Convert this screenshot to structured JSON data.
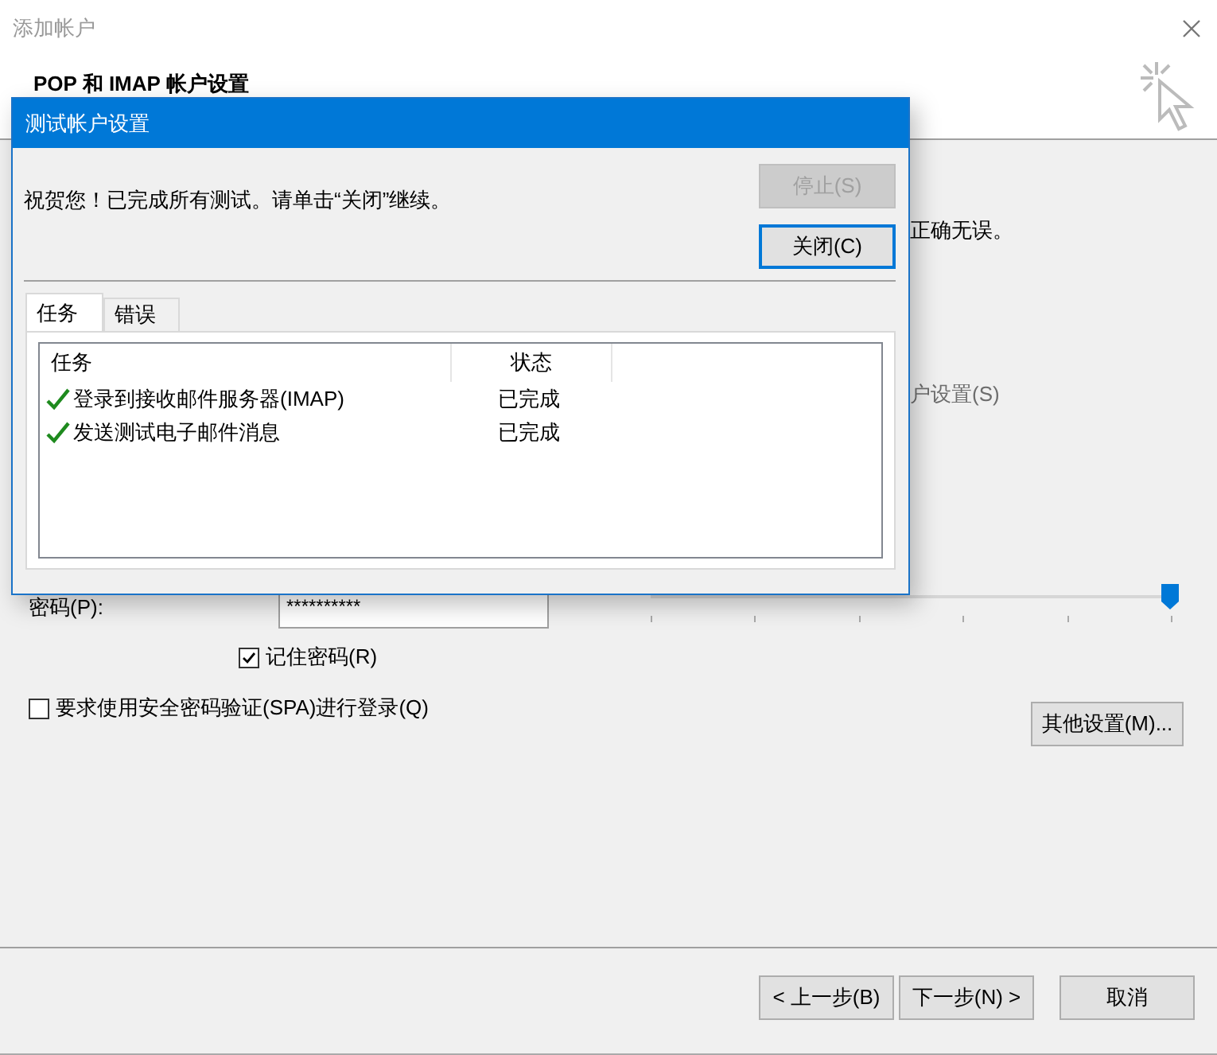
{
  "window": {
    "title": "添加帐户"
  },
  "header": {
    "title": "POP 和 IMAP 帐户设置"
  },
  "partial_texts": [
    {
      "text": "正确无误。",
      "disabled": false
    },
    {
      "text": "户设置(S)",
      "disabled": true
    }
  ],
  "password": {
    "label": "密码(P):",
    "value": "**********"
  },
  "slider": {
    "level": 1
  },
  "remember": {
    "label": "记住密码(R)",
    "checked": true
  },
  "spa": {
    "label": "要求使用安全密码验证(SPA)进行登录(Q)",
    "checked": false
  },
  "more_button": {
    "label": "其他设置(M)..."
  },
  "footer_buttons": [
    {
      "label": "< 上一步(B)"
    },
    {
      "label": "下一步(N) >"
    },
    {
      "label": "取消"
    }
  ],
  "dialog": {
    "title": "测试帐户设置",
    "message": "祝贺您！已完成所有测试。请单击“关闭”继续。",
    "buttons": [
      {
        "label": "停止(S)",
        "disabled": true,
        "focused": false
      },
      {
        "label": "关闭(C)",
        "disabled": false,
        "focused": true
      }
    ],
    "tabs": [
      {
        "label": "任务",
        "selected": true
      },
      {
        "label": "错误",
        "selected": false
      }
    ],
    "columns": [
      "任务",
      "状态"
    ],
    "rows": [
      {
        "task": "登录到接收邮件服务器(IMAP)",
        "status": "已完成",
        "kind": "success"
      },
      {
        "task": "发送测试电子邮件消息",
        "status": "已完成",
        "kind": "success"
      }
    ]
  }
}
